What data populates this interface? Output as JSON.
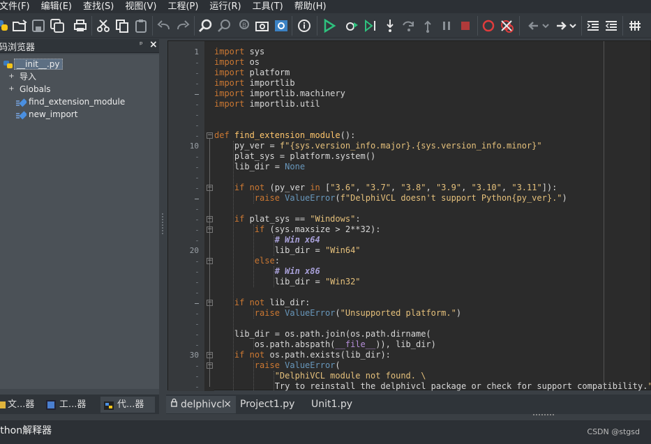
{
  "menu": [
    "文件(F)",
    "编辑(E)",
    "查找(S)",
    "视图(V)",
    "工程(P)",
    "运行(R)",
    "工具(T)",
    "帮助(H)"
  ],
  "toolbar_icons": [
    "python-icon",
    "open-icon",
    "save-icon",
    "save-all-icon",
    "print-icon",
    "cut-icon",
    "copy-icon",
    "paste-icon",
    "undo-icon",
    "redo-icon",
    "find-icon",
    "find-replace-icon",
    "replace-icon",
    "find-in-files-icon",
    "search-highlight-icon",
    "info-icon",
    "run-icon",
    "debug-icon",
    "run-to-cursor-icon",
    "step-into-icon",
    "step-over-icon",
    "step-out-icon",
    "pause-icon",
    "stop-icon",
    "breakpoint-icon",
    "clear-breakpoints-icon",
    "back-icon",
    "back-dropdown-icon",
    "forward-icon",
    "forward-dropdown-icon",
    "indent-icon",
    "unindent-icon",
    "grid-icon"
  ],
  "left_panel": {
    "title": "码浏览器",
    "pin": "ᵖ",
    "close": "×",
    "tree": {
      "root": "__init__.py",
      "imports": "导入",
      "globals": "Globals",
      "functions": [
        "find_extension_module",
        "new_import"
      ]
    },
    "tabs": [
      "文...器",
      "工...器",
      "代...器"
    ]
  },
  "editor": {
    "tabs": [
      "delphivcl",
      "Project1.py",
      "Unit1.py"
    ],
    "active_tab_close": "×",
    "line_numbers": {
      "1": "1",
      "10": "10",
      "20": "20",
      "30": "30"
    },
    "lines": [
      "import sys",
      "import os",
      "import platform",
      "import importlib",
      "import importlib.machinery",
      "import importlib.util",
      "",
      "",
      "def find_extension_module():",
      "    py_ver = f\"{sys.version_info.major}.{sys.version_info.minor}\"",
      "    plat_sys = platform.system()",
      "    lib_dir = None",
      "",
      "    if not (py_ver in [\"3.6\", \"3.7\", \"3.8\", \"3.9\", \"3.10\", \"3.11\"]):",
      "        raise ValueError(f\"DelphiVCL doesn't support Python{py_ver}.\")",
      "",
      "    if plat_sys == \"Windows\":",
      "        if (sys.maxsize > 2**32):",
      "            # Win x64",
      "            lib_dir = \"Win64\"",
      "        else:",
      "            # Win x86",
      "            lib_dir = \"Win32\"",
      "",
      "    if not lib_dir:",
      "        raise ValueError(\"Unsupported platform.\")",
      "",
      "    lib_dir = os.path.join(os.path.dirname(",
      "        os.path.abspath(__file__)), lib_dir)",
      "    if not os.path.exists(lib_dir):",
      "        raise ValueError(",
      "            \"DelphiVCL module not found. \\",
      "            Try to reinstall the delphivcl package or check for support compatibility.\")"
    ]
  },
  "status": {
    "panel_title": "ython解释器",
    "watermark": "CSDN @stgsd"
  },
  "colors": {
    "keyword": "#cc7832",
    "string": "#e5c07b",
    "function": "#ffc66d",
    "comment": "#a8a0d8",
    "constant": "#6897bb"
  }
}
